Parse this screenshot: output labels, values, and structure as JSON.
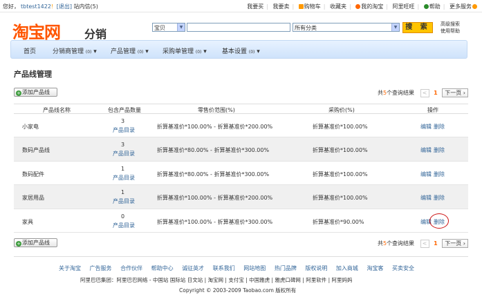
{
  "topbar": {
    "greeting": "您好，",
    "username": "tbtest1422",
    "logout": "[退出]",
    "messages": "站内信(5)",
    "links": [
      "我要买",
      "我要卖",
      "购物车",
      "收藏夹",
      "我的淘宝",
      "阿里旺旺",
      "帮助",
      "更多服务"
    ]
  },
  "header": {
    "logo": "淘宝网",
    "logo_sub": "分销",
    "search_scope": "宝贝",
    "search_value": "",
    "category": "所有分类",
    "search_button": "搜 索",
    "advanced_search": "高级搜索",
    "usage_help": "使用帮助"
  },
  "nav": {
    "items": [
      "首页",
      "分销商管理",
      "产品管理",
      "采购单管理",
      "基本设置"
    ],
    "badges": [
      "",
      "(0)",
      "(0)",
      "(0)",
      "(0)"
    ]
  },
  "page": {
    "title": "产品线管理",
    "add_button": "添加产品线"
  },
  "pager": {
    "prefix": "共",
    "count": "5",
    "suffix": "个查询结果",
    "current_page": "1",
    "prev": "<",
    "next": "下一页"
  },
  "table": {
    "headers": [
      "产品线名称",
      "包含产品数量",
      "零售价范围(%)",
      "采购价(%)",
      "操作"
    ],
    "catalog_label": "产品目录",
    "edit_label": "编辑",
    "delete_label": "删除",
    "rows": [
      {
        "name": "小家电",
        "count": "3",
        "retail": "折算基准价*100.00% - 折算基准价*200.00%",
        "purchase": "折算基准价*100.00%"
      },
      {
        "name": "数码产品线",
        "count": "3",
        "retail": "折算基准价*80.00% - 折算基准价*300.00%",
        "purchase": "折算基准价*100.00%"
      },
      {
        "name": "数码配件",
        "count": "1",
        "retail": "折算基准价*80.00% - 折算基准价*300.00%",
        "purchase": "折算基准价*100.00%"
      },
      {
        "name": "家居用品",
        "count": "1",
        "retail": "折算基准价*100.00% - 折算基准价*200.00%",
        "purchase": "折算基准价*100.00%"
      },
      {
        "name": "家具",
        "count": "0",
        "retail": "折算基准价*100.00% - 折算基准价*300.00%",
        "purchase": "折算基准价*90.00%"
      }
    ]
  },
  "footer": {
    "links": [
      "关于淘宝",
      "广告服务",
      "合作伙伴",
      "帮助中心",
      "诚征英才",
      "联系我们",
      "网站地图",
      "热门品牌",
      "版权说明",
      "加入商城",
      "淘宝客",
      "买卖安全"
    ],
    "group_label": "阿里巴巴集团：",
    "group_text": "阿里巴巴网络 - 中国站 国际站 日文站 | 淘宝网 | 支付宝 | 中国雅虎 | 雅虎口碑网 | 阿里软件 | 阿里妈妈",
    "copyright": "Copyright © 2003-2009 Taobao.com 版权所有"
  },
  "colors": {
    "brand": "#ff5500",
    "link": "#336699",
    "nav_bg": "#d8e8fc",
    "search_button": "#ffc400",
    "annotation": "#cc1111"
  }
}
